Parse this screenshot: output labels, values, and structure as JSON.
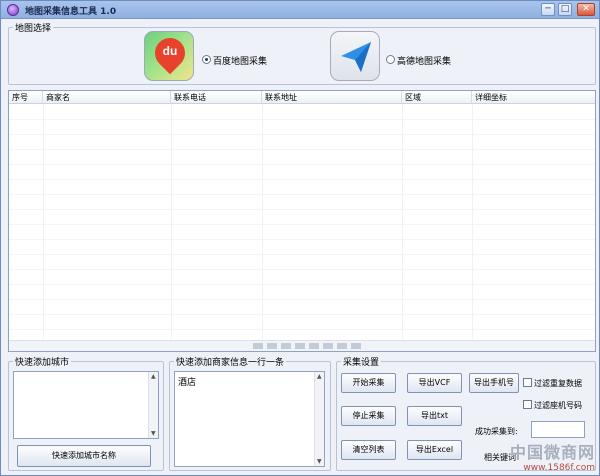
{
  "window": {
    "title": "地图采集信息工具 1.0",
    "minimize": "─",
    "maximize": "□",
    "close": "✕"
  },
  "map_group": {
    "legend": "地图选择",
    "options": [
      {
        "label": "百度地图采集",
        "selected": true,
        "icon": "baidu-map-icon",
        "icon_text": "du"
      },
      {
        "label": "高德地图采集",
        "selected": false,
        "icon": "gaode-map-icon"
      }
    ]
  },
  "table": {
    "columns": [
      "序号",
      "商家名",
      "联系电话",
      "联系地址",
      "区域",
      "详细坐标"
    ],
    "rows": []
  },
  "city_group": {
    "legend": "快速添加城市",
    "value": "",
    "button": "快速添加城市名称"
  },
  "merchant_group": {
    "legend": "快速添加商家信息一行一条",
    "value": "酒店"
  },
  "collect_group": {
    "legend": "采集设置",
    "buttons": {
      "start": "开始采集",
      "stop": "停止采集",
      "clear": "清空列表",
      "export_vcf": "导出VCF",
      "export_txt": "导出txt",
      "export_excel": "导出Excel",
      "export_phone": "导出手机号"
    },
    "filters": {
      "dedupe": "过滤重复数据",
      "landline": "过滤座机号码"
    },
    "success_label": "成功采集到:",
    "success_value": "",
    "keyword_label": "相关键词:"
  },
  "watermark": {
    "text": "中国微商网",
    "url": "www.1586f.com"
  },
  "colors": {
    "accent": "#8fb0e2",
    "background": "#eef2f8",
    "border": "#8ea3c2"
  }
}
